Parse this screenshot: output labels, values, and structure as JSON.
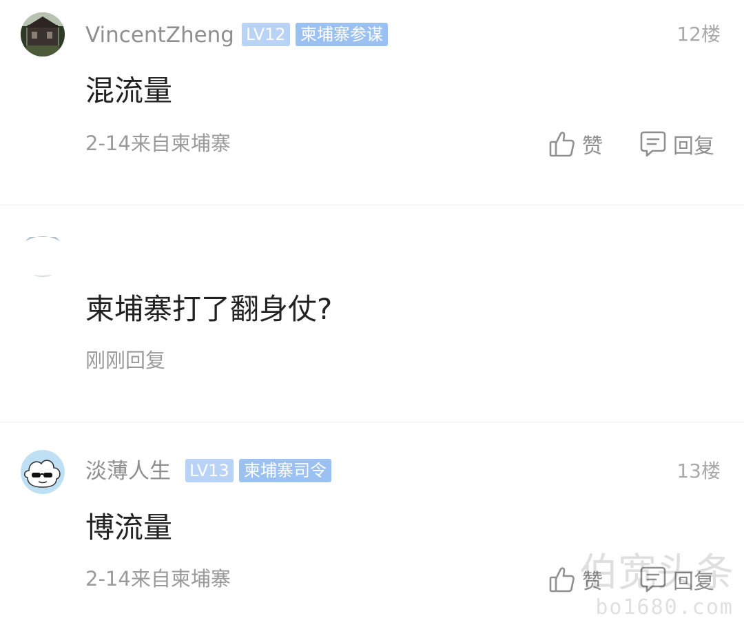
{
  "comments": [
    {
      "username": "VincentZheng",
      "level": "LV12",
      "title": "柬埔寨参谋",
      "floor": "12楼",
      "content": "混流量",
      "meta": "2-14来自柬埔寨",
      "like_label": "赞",
      "reply_label": "回复"
    },
    {
      "content": "柬埔寨打了翻身仗?",
      "meta": "刚刚回复"
    },
    {
      "username": "淡薄人生",
      "level": "LV13",
      "title": "柬埔寨司令",
      "floor": "13楼",
      "content": "博流量",
      "meta": "2-14来自柬埔寨",
      "like_label": "赞",
      "reply_label": "回复"
    }
  ],
  "watermark": {
    "line1": "伯宽头条",
    "line2": "bo1680.com"
  },
  "icons": {
    "like": "thumbs-up-icon",
    "reply": "comment-bubble-icon"
  },
  "colors": {
    "level_badge": "#b9d3f7",
    "title_badge": "#9bc1f3",
    "username": "#8f8f8f",
    "content": "#222222",
    "meta": "#9a9a9a"
  }
}
